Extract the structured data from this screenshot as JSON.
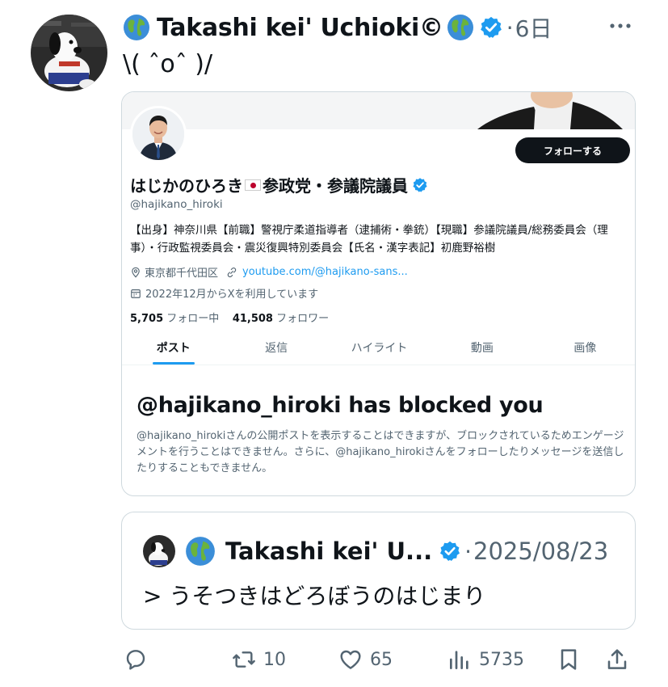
{
  "tweet": {
    "author_name": "Takashi kei' Uchioki©",
    "time": "6日",
    "separator": "·",
    "text": "\\( ˆoˆ )/"
  },
  "profile_card": {
    "follow_label": "フォローする",
    "name_part1": "はじかのひろき",
    "name_part2": "参政党・参議院議員",
    "handle": "@hajikano_hiroki",
    "bio": "【出身】神奈川県【前職】警視庁柔道指導者（逮捕術・拳銃）【現職】参議院議員/総務委員会（理事）・行政監視委員会・震災復興特別委員会【氏名・漢字表記】初鹿野裕樹",
    "location": "東京都千代田区",
    "link": "youtube.com/@hajikano-sans...",
    "joined": "2022年12月からXを利用しています",
    "following_count": "5,705",
    "following_label": "フォロー中",
    "followers_count": "41,508",
    "followers_label": "フォロワー",
    "tabs": [
      "ポスト",
      "返信",
      "ハイライト",
      "動画",
      "画像"
    ],
    "blocked_title": "@hajikano_hiroki has blocked you",
    "blocked_text": "@hajikano_hirokiさんの公開ポストを表示することはできますが、ブロックされているためエンゲージメントを行うことはできません。さらに、@hajikano_hirokiさんをフォローしたりメッセージを送信したりすることもできません。"
  },
  "quote": {
    "author_name": "Takashi kei' U...",
    "separator": "·",
    "date": "2025/08/23",
    "text": "> うそつきはどろぼうのはじまり"
  },
  "actions": {
    "retweets": "10",
    "likes": "65",
    "views": "5735"
  },
  "colors": {
    "verified": "#1d9bf0",
    "secondary_text": "#536471",
    "border": "#cfd9de"
  },
  "icons": [
    "globe-icon",
    "verified-icon",
    "more-icon",
    "location-icon",
    "link-icon",
    "calendar-icon",
    "reply-icon",
    "retweet-icon",
    "like-icon",
    "views-icon",
    "bookmark-icon",
    "share-icon"
  ]
}
